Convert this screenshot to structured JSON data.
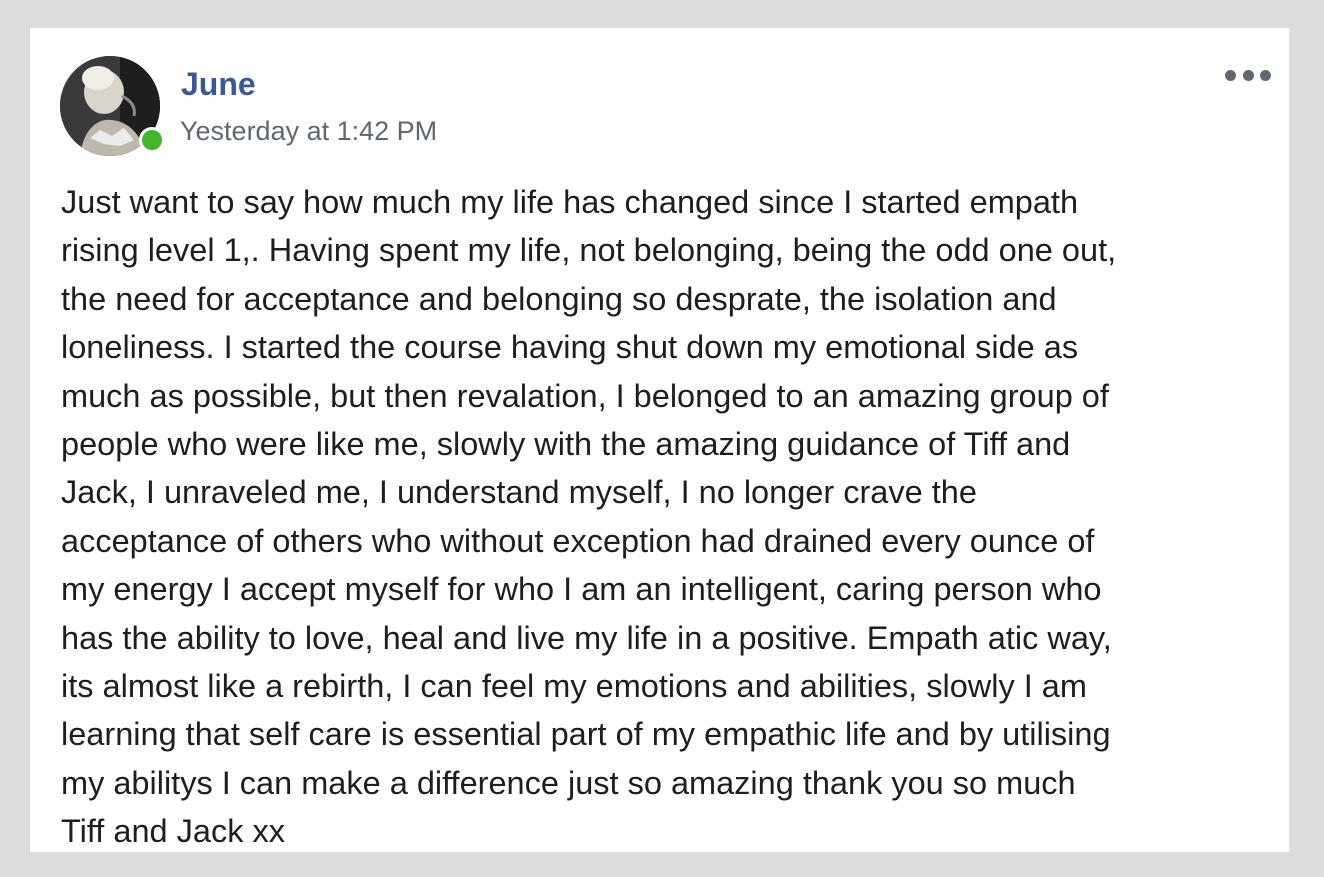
{
  "post": {
    "author": "June",
    "timestamp": "Yesterday at 1:42 PM",
    "online": true,
    "body": "Just want to say how much my life has changed since I started empath\nrising level 1,. Having spent my life, not belonging, being the odd one out,\nthe need for acceptance and belonging so desprate, the isolation and\nloneliness. I started the course having shut down my emotional side as\nmuch as possible, but then revalation, I belonged to an amazing group of\npeople who were like me, slowly with the amazing guidance of Tiff and\nJack, I unraveled me, I understand myself, I no longer crave the\nacceptance of others who without exception had drained every ounce of\nmy energy I accept myself for who I am an intelligent, caring person who\nhas the ability to love, heal and live my life in a positive. Empath atic way,\nits almost like a rebirth, I can feel my emotions and abilities, slowly I am\nlearning that self care is essential part of my empathic life and by utilising\nmy abilitys I can make a difference just so amazing thank you so much\nTiff and Jack xx"
  },
  "icons": {
    "more": "more-horizontal-icon",
    "presence": "online-presence-icon"
  },
  "colors": {
    "name": "#385898",
    "timestamp": "#616770",
    "body_text": "#1c1e21",
    "presence": "#42b72a",
    "background": "#dcdcdc",
    "card": "#ffffff"
  }
}
